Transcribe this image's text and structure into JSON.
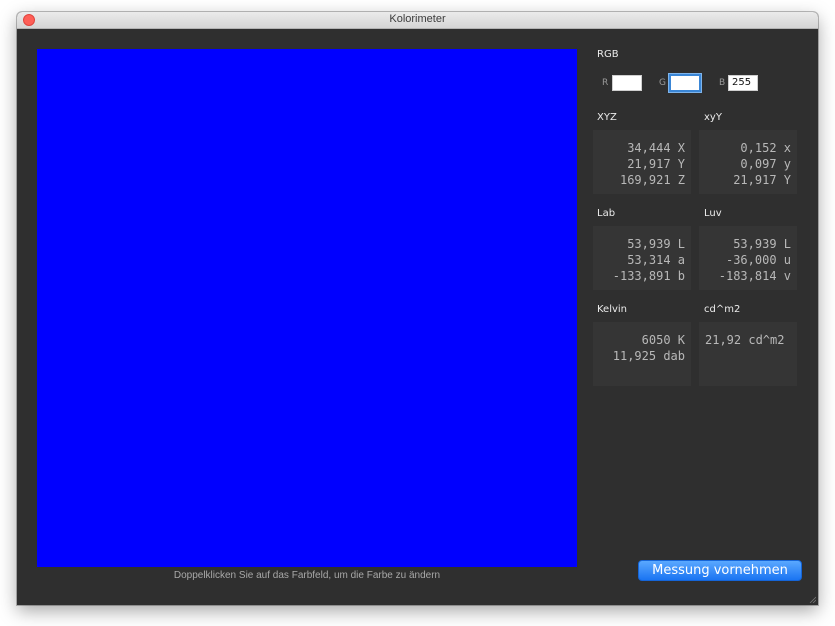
{
  "window": {
    "title": "Kolorimeter"
  },
  "swatch": {
    "color": "#0000ff",
    "hint": "Doppelklicken Sie auf das Farbfeld, um die Farbe zu ändern"
  },
  "rgb": {
    "label": "RGB",
    "r_label": "R",
    "r_value": "",
    "g_label": "G",
    "g_value": "",
    "b_label": "B",
    "b_value": "255"
  },
  "xyz": {
    "label": "XYZ",
    "lines": "34,444 X\n21,917 Y\n169,921 Z"
  },
  "xyY": {
    "label": "xyY",
    "lines": "0,152 x\n0,097 y\n21,917 Y"
  },
  "lab": {
    "label": "Lab",
    "lines": "53,939 L\n53,314 a\n-133,891 b"
  },
  "luv": {
    "label": "Luv",
    "lines": "53,939 L\n-36,000 u\n-183,814 v"
  },
  "kelvin": {
    "label": "Kelvin",
    "lines": "6050 K\n11,925 dab"
  },
  "cdm2": {
    "label": "cd^m2",
    "lines": "21,92 cd^m2"
  },
  "actions": {
    "measure_label": "Messung vornehmen"
  }
}
